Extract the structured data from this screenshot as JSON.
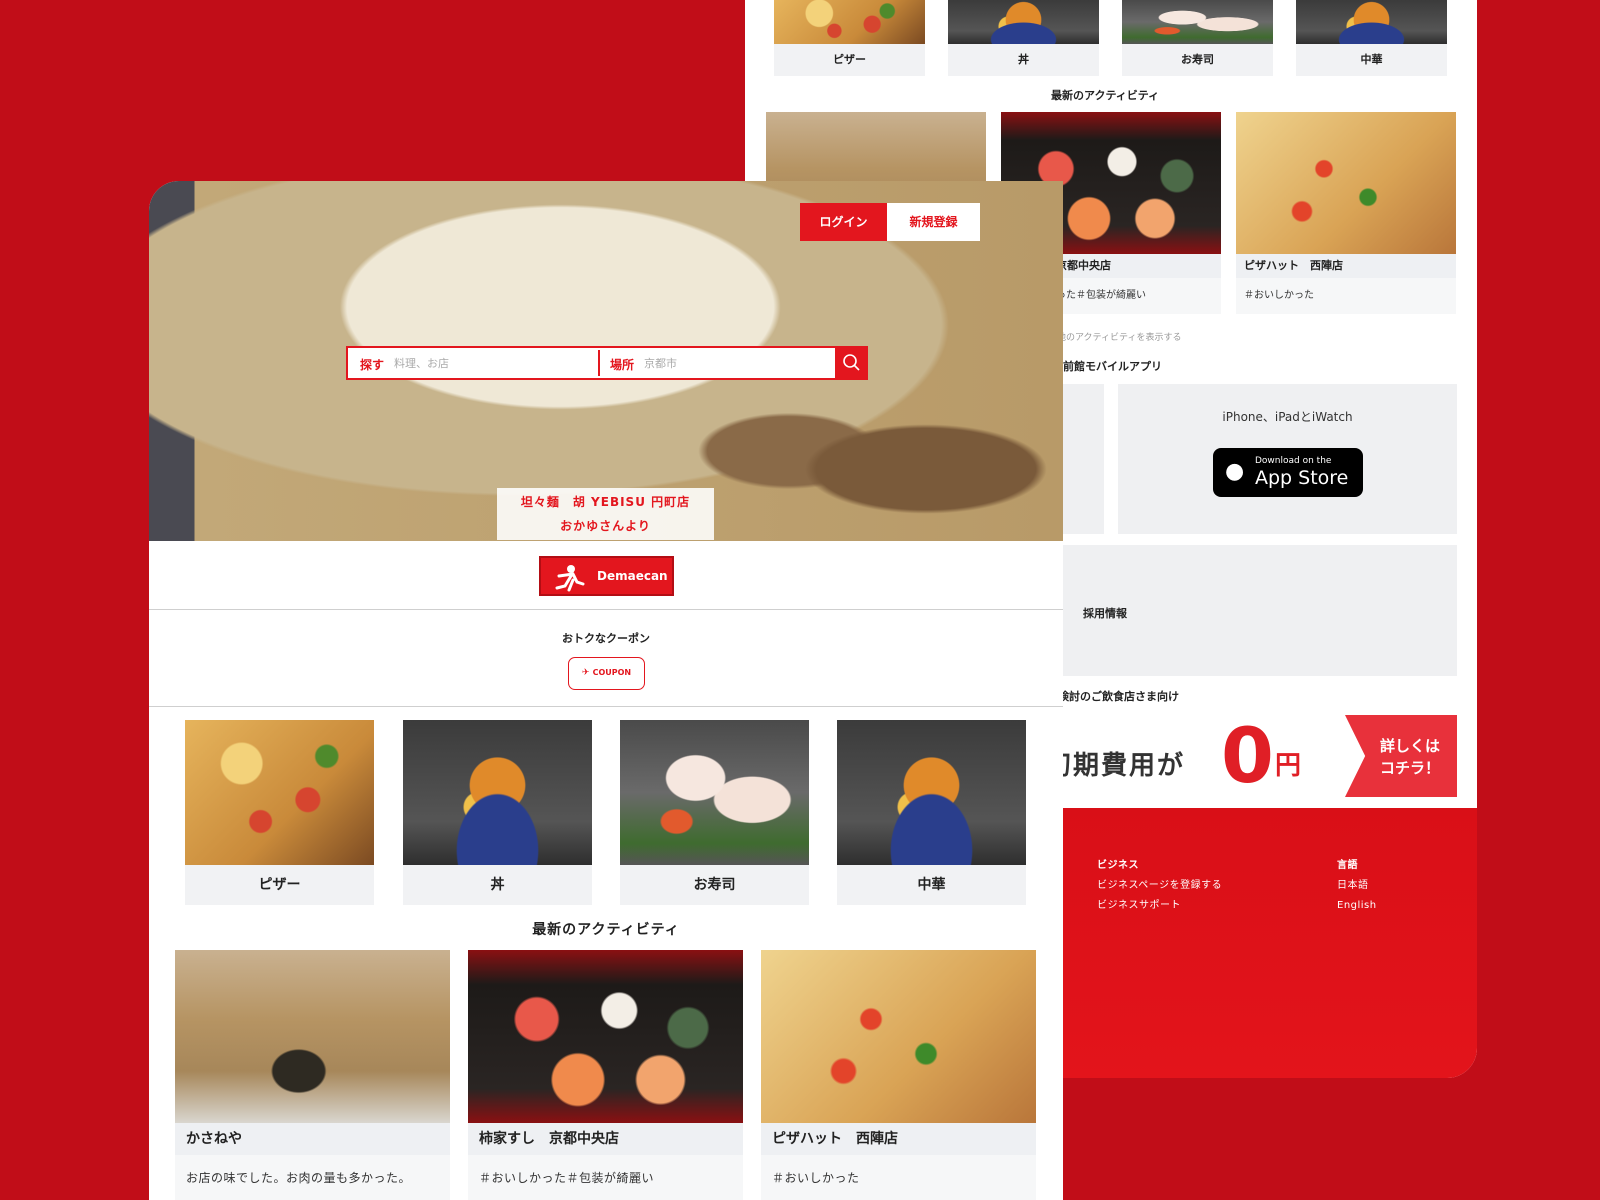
{
  "colors": {
    "brand": "#e3161e",
    "background": "#c10d18"
  },
  "back": {
    "categories": [
      "ピザー",
      "丼",
      "お寿司",
      "中華"
    ],
    "latest_title": "最新のアクティビティ",
    "activities": [
      {
        "name": "",
        "desc": ""
      },
      {
        "name": "京都中央店",
        "desc": "った＃包装が綺麗い"
      },
      {
        "name": "ピザハット　西陣店",
        "desc": "＃おいしかった"
      }
    ],
    "more_link": "他のアクティビティを表示する",
    "app_title": "前館モバイルアプリ",
    "app_devices": "iPhone、iPadとiWatch",
    "appstore_small": "Download on the",
    "appstore_big": "App Store",
    "recruit": "採用情報",
    "restaurant_title": "検討のご飲食店さま向け",
    "banner": {
      "text": "初期費用が",
      "zero": "0",
      "yen": "円",
      "cta_line1": "詳しくは",
      "cta_line2": "コチラ！"
    },
    "footer": {
      "business_heading": "ビジネス",
      "business_links": [
        "ビジネスページを登録する",
        "ビジネスサポート"
      ],
      "language_heading": "言語",
      "languages": [
        "日本語",
        "English"
      ]
    }
  },
  "front": {
    "login": "ログイン",
    "signup": "新規登録",
    "search": {
      "find_label": "探す",
      "find_placeholder": "料理、お店",
      "place_label": "場所",
      "place_placeholder": "京都市"
    },
    "caption_line1": "坦々麺　胡 YEBISU 円町店",
    "caption_line2": "おかゆさんより",
    "logo_text": "Demaecan",
    "coupon_title": "おトクなクーポン",
    "coupon_label": "COUPON",
    "categories": [
      "ピザー",
      "丼",
      "お寿司",
      "中華"
    ],
    "latest_title": "最新のアクティビティ",
    "activities": [
      {
        "name": "かさねや",
        "desc": "お店の味でした。お肉の量も多かった。"
      },
      {
        "name": "柿家すし　京都中央店",
        "desc": "＃おいしかった＃包装が綺麗い"
      },
      {
        "name": "ピザハット　西陣店",
        "desc": "＃おいしかった"
      }
    ]
  }
}
